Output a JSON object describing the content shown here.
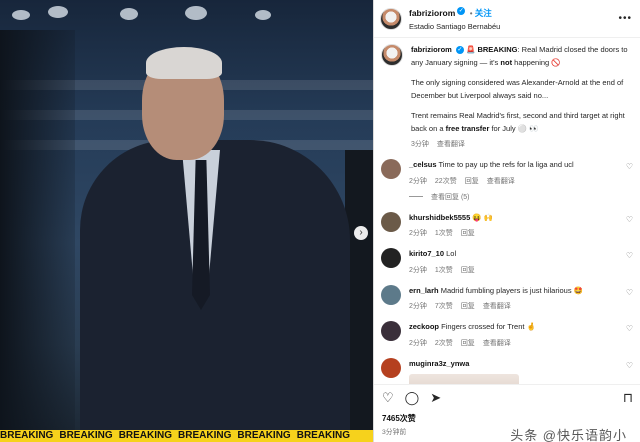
{
  "photo": {
    "next_glyph": "›",
    "strip_text": "BREAKING"
  },
  "post": {
    "username": "fabriziorom",
    "follow_label": "关注",
    "location": "Estadio Santiago Bernabéu",
    "caption_prefix": "🚨",
    "caption_breaking": "BREAKING",
    "caption_line1": ": Real Madrid closed the doors to any January signing — it's ",
    "caption_not": "not",
    "caption_line1_end": " happening 🚫",
    "caption_para2": "The only signing considered was Alexander-Arnold at the end of December but Liverpool always said no...",
    "caption_para3_start": "Trent remains Real Madrid's first, second and third target at right back on a ",
    "caption_free": "free transfer",
    "caption_para3_end": " for July ⚪️ 👀",
    "caption_time": "3分钟",
    "caption_translate": "查看翻译"
  },
  "comments": [
    {
      "username": "_celsus",
      "text": "Time to pay up the refs for la liga and ucl",
      "time": "2分钟",
      "likes": "22次赞",
      "reply": "回复",
      "translate": "查看翻译",
      "avatar_color": "#8a6a5a",
      "replies": "查看回复 (5)"
    },
    {
      "username": "khurshidbek5555",
      "text": "😝 🙌",
      "time": "2分钟",
      "likes": "1次赞",
      "reply": "回复",
      "translate": "",
      "avatar_color": "#6b5a48"
    },
    {
      "username": "kirito7_10",
      "text": "Lol",
      "time": "2分钟",
      "likes": "1次赞",
      "reply": "回复",
      "translate": "",
      "avatar_color": "#222222"
    },
    {
      "username": "ern_larh",
      "text": "Madrid fumbling players is just hilarious 🤩",
      "time": "2分钟",
      "likes": "7次赞",
      "reply": "回复",
      "translate": "查看翻译",
      "avatar_color": "#5d7a8a"
    },
    {
      "username": "zeckoop",
      "text": "Fingers crossed for Trent 🤞",
      "time": "2分钟",
      "likes": "2次赞",
      "reply": "回复",
      "translate": "查看翻译",
      "avatar_color": "#3a2f3a"
    },
    {
      "username": "muginra3z_ynwa",
      "text": "",
      "time": "",
      "likes": "",
      "reply": "",
      "translate": "",
      "avatar_color": "#b5401f"
    }
  ],
  "actions": {
    "like_icon": "♡",
    "comment_icon": "◯",
    "share_icon": "➤",
    "save_icon": "⊓",
    "likes_text": "7465次赞",
    "time_text": "3分钟前"
  },
  "watermark": "头条 @快乐语韵小"
}
